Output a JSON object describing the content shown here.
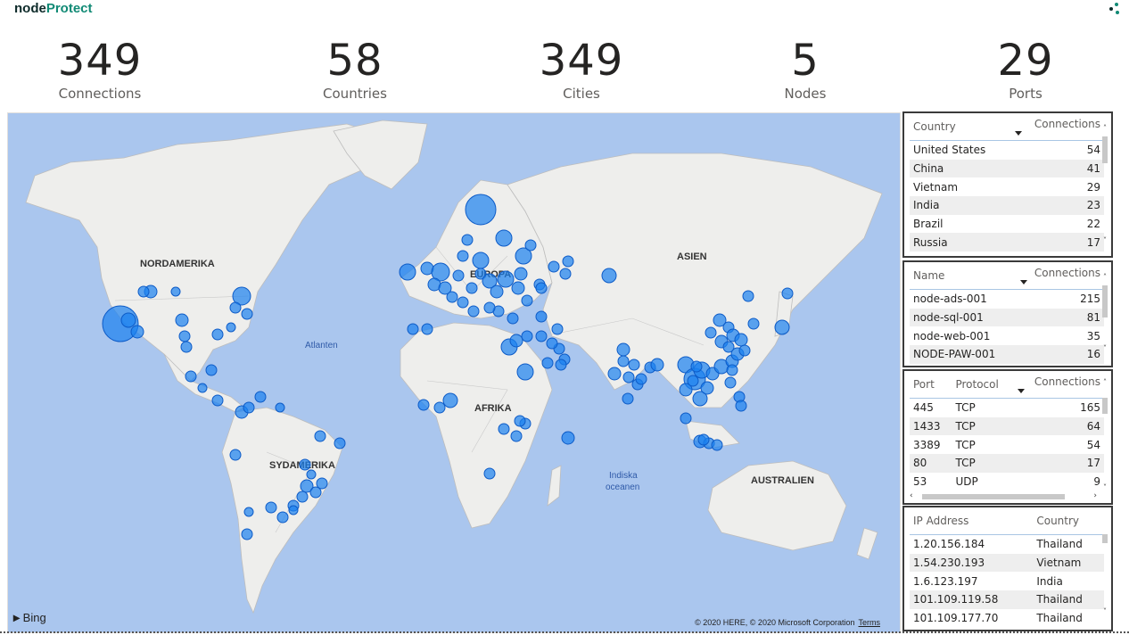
{
  "brand": {
    "part1": "node",
    "part2": "Protect"
  },
  "kpis": [
    {
      "value": "349",
      "label": "Connections"
    },
    {
      "value": "58",
      "label": "Countries"
    },
    {
      "value": "349",
      "label": "Cities"
    },
    {
      "value": "5",
      "label": "Nodes"
    },
    {
      "value": "29",
      "label": "Ports"
    }
  ],
  "map": {
    "labels": {
      "north_america": "NORDAMERIKA",
      "south_america": "SYDAMERIKA",
      "europe": "EUROPA",
      "asia": "ASIEN",
      "africa": "AFRIKA",
      "australia": "AUSTRALIEN",
      "atlantic": "Atlanten",
      "indian_ocean_1": "Indiska",
      "indian_ocean_2": "oceanen"
    },
    "bing": "Bing",
    "copyright": "© 2020 HERE, © 2020 Microsoft Corporation",
    "terms": "Terms",
    "colors": {
      "water": "#aac6ee",
      "land": "#eeeeec",
      "border": "#bdbdbd",
      "bubble": "#1a80f0",
      "bubble_stroke": "#0d5bc7"
    }
  },
  "country_table": {
    "headers": [
      "Country",
      "Connections"
    ],
    "rows": [
      [
        "United States",
        "54"
      ],
      [
        "China",
        "41"
      ],
      [
        "Vietnam",
        "29"
      ],
      [
        "India",
        "23"
      ],
      [
        "Brazil",
        "22"
      ],
      [
        "Russia",
        "17"
      ]
    ]
  },
  "node_table": {
    "headers": [
      "Name",
      "Connections"
    ],
    "rows": [
      [
        "node-ads-001",
        "215"
      ],
      [
        "node-sql-001",
        "81"
      ],
      [
        "node-web-001",
        "35"
      ],
      [
        "NODE-PAW-001",
        "16"
      ]
    ]
  },
  "port_table": {
    "headers": [
      "Port",
      "Protocol",
      "Connections"
    ],
    "rows": [
      [
        "445",
        "TCP",
        "165"
      ],
      [
        "1433",
        "TCP",
        "64"
      ],
      [
        "3389",
        "TCP",
        "54"
      ],
      [
        "80",
        "TCP",
        "17"
      ],
      [
        "53",
        "UDP",
        "9"
      ]
    ]
  },
  "ip_table": {
    "headers": [
      "IP Address",
      "Country"
    ],
    "rows": [
      [
        "1.20.156.184",
        "Thailand"
      ],
      [
        "1.54.230.193",
        "Vietnam"
      ],
      [
        "1.6.123.197",
        "India"
      ],
      [
        "101.109.119.58",
        "Thailand"
      ],
      [
        "101.109.177.70",
        "Thailand"
      ]
    ]
  }
}
